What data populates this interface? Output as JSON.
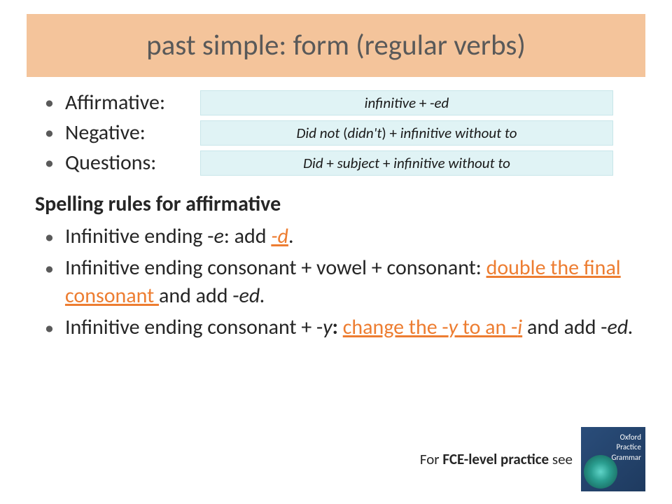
{
  "title": "past simple: form (regular verbs)",
  "forms": [
    {
      "label": "Affirmative:",
      "value_html": "infinitive <span class='plain'>+ -</span>ed"
    },
    {
      "label": "Negative:",
      "value_html": "Did not <span class='plain'>(</span>didn't<span class='plain'>) +</span> infinitive without to"
    },
    {
      "label": "Questions:",
      "value_html": "Did <span class='plain'>+</span> subject <span class='plain'>+</span> infinitive without to"
    }
  ],
  "section_heading": "Spelling rules for affirmative",
  "rules": [
    "Infinitive ending -<span class='italic'>e</span>: add <a class='link-orange italic'>-d</a>.",
    "Infinitive ending consonant + vowel + consonant: <a class='link-orange'>double the final consonant </a>and add -<span class='italic'>ed.</span>",
    "Infinitive ending consonant + -<span class='italic'>y</span><b>:</b> <a class='link-orange'>change the -<span class='italic'>y</span> to an -<span class='italic'>i</span></a> and add -<span class='italic'>ed.</span>"
  ],
  "footer": {
    "prefix": "For ",
    "bold": "FCE-level practice",
    "suffix": " see",
    "book": {
      "line1": "Oxford",
      "line2": "Practice",
      "line3": "Grammar"
    }
  }
}
